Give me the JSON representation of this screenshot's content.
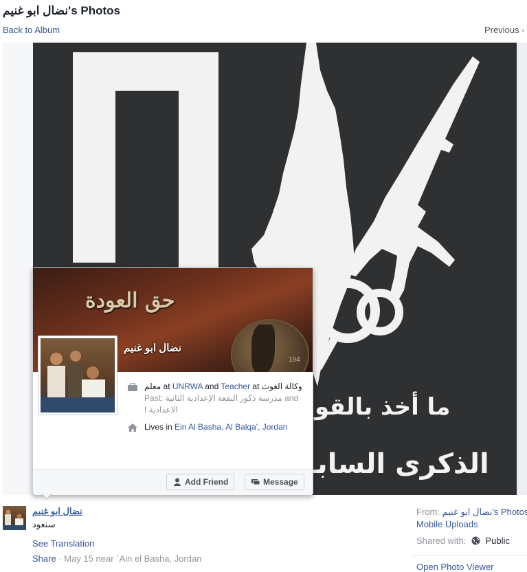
{
  "header": {
    "title": "نضال ابو غنيم's Photos",
    "back_link": "Back to Album",
    "previous_link": "Previous"
  },
  "photo": {
    "caption_line1": "ما أخذ بالقو",
    "caption_line2": "الذكرى السابـ"
  },
  "hovercard": {
    "cover_title": "حق العودة",
    "medal_number": "194",
    "name": "نضال ابو غنيم",
    "work": {
      "role": "معلم",
      "at1": " at ",
      "org1": "UNRWA",
      "and": " and ",
      "role2": "Teacher",
      "at2": " at ",
      "org2": "وكالة الغوث"
    },
    "past": {
      "label": "Past: ",
      "value": "مدرسة ذكور البقعة الإعدادية الثانية",
      "and": " and ",
      "value2": "الاعدادية ا"
    },
    "lives": {
      "label": "Lives in ",
      "place": "Ein Al Basha, Al Balqa', Jordan"
    },
    "add_friend_label": "Add Friend",
    "message_label": "Message"
  },
  "post": {
    "owner_name": "نضال ابو غنيم",
    "caption": "سنعود",
    "see_translation": "See Translation",
    "share": "Share",
    "meta": " · May 15 near `Ain el Basha, Jordan"
  },
  "sidebar": {
    "from_label": "From: ",
    "from_value": "نضال ابو غنيم's Photos in",
    "album": "Mobile Uploads",
    "shared_label": "Shared with:",
    "shared_value": "Public",
    "open_viewer": "Open Photo Viewer"
  },
  "colors": {
    "link": "#365899",
    "muted": "#90949c",
    "photo_bg": "#2f3032"
  },
  "icons": [
    "briefcase-icon",
    "home-icon",
    "add-friend-icon",
    "message-icon",
    "globe-icon"
  ]
}
